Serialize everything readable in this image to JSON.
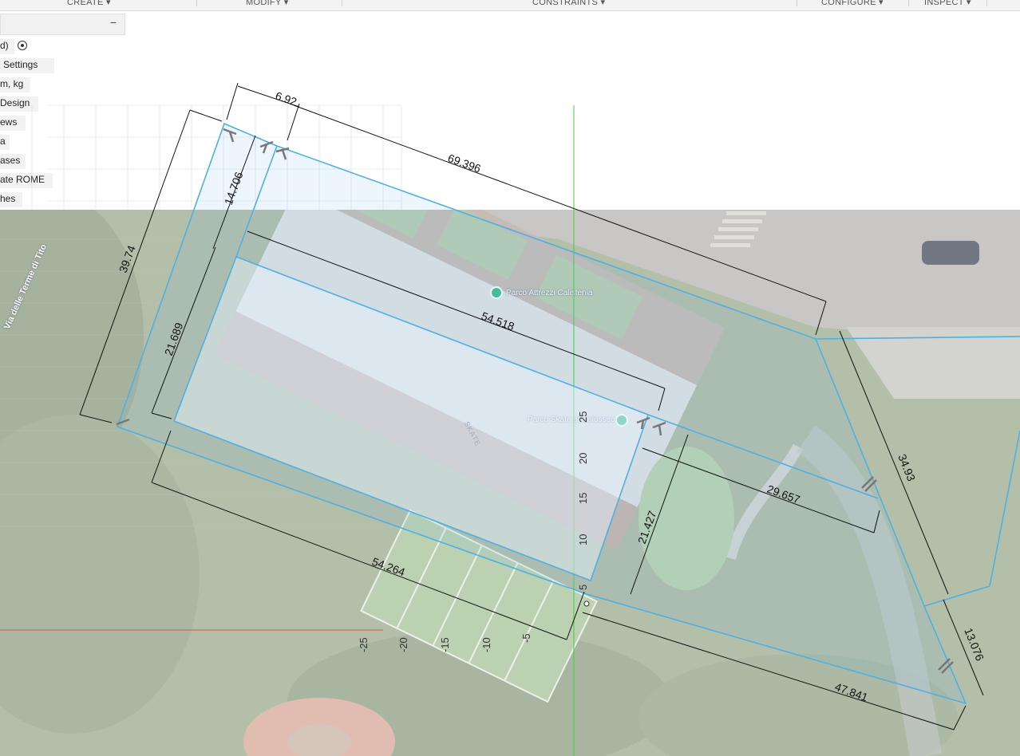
{
  "toolbar": {
    "groups": [
      {
        "label": "CREATE ▾"
      },
      {
        "label": "MODIFY ▾"
      },
      {
        "label": "CONSTRAINTS ▾"
      },
      {
        "label": "CONFIGURE ▾"
      },
      {
        "label": "INSPECT ▾"
      }
    ]
  },
  "browser": {
    "collapse_label": "−",
    "items": [
      {
        "label": "d)"
      },
      {
        "label": "Settings"
      },
      {
        "label": "m, kg"
      },
      {
        "label": "Design"
      },
      {
        "label": "ews"
      },
      {
        "label": "a"
      },
      {
        "label": "ases"
      },
      {
        "label": "ate ROME"
      },
      {
        "label": "hes"
      }
    ]
  },
  "map": {
    "street_label": "Via delle Terme di Tito",
    "poi_1": "Parco Attrezzi Calistenia",
    "poi_2": "Parco Skate al Colosseo",
    "skate_mark": "SKATE"
  },
  "sketch": {
    "line_color": "#4fb0e0",
    "dimension_color": "#111111",
    "axis_green": "#44cc44",
    "axis_red": "#e05050",
    "dimensions": [
      "6.92",
      "69.396",
      "14.706",
      "39.74",
      "54.518",
      "21.689",
      "34.93",
      "29.657",
      "21.427",
      "54.264",
      "13.076",
      "47.841"
    ],
    "vertical_ticks": [
      "25",
      "20",
      "15",
      "10",
      "5"
    ],
    "horizontal_ticks": [
      "-25",
      "-20",
      "-15",
      "-10",
      "-5"
    ]
  }
}
